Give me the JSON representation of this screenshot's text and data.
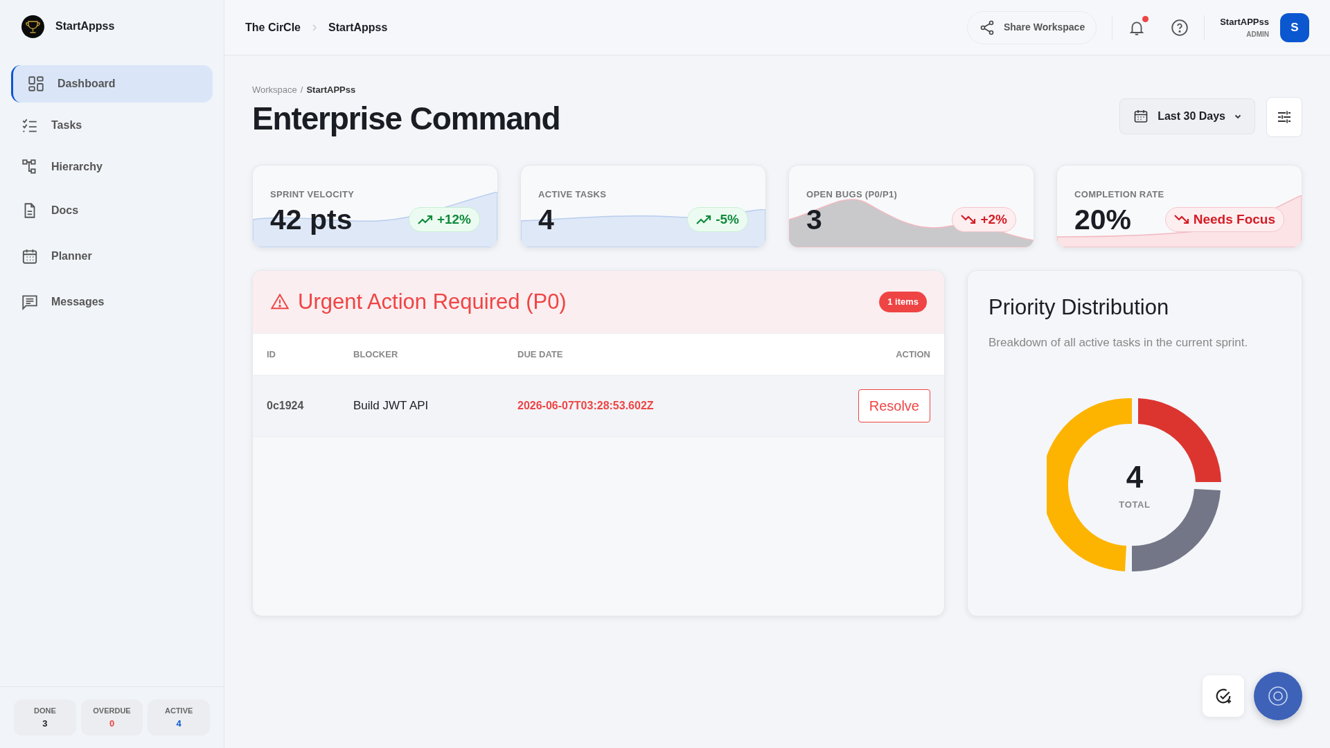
{
  "sidebar": {
    "brand": "StartAppss",
    "items": [
      {
        "label": "Dashboard",
        "selected": true
      },
      {
        "label": "Tasks",
        "selected": false
      },
      {
        "label": "Hierarchy",
        "selected": false
      },
      {
        "label": "Docs",
        "selected": false
      },
      {
        "label": "Planner",
        "selected": false
      },
      {
        "label": "Messages",
        "selected": false
      }
    ],
    "stats": [
      {
        "label": "DONE",
        "value": "3",
        "kind": "neutral"
      },
      {
        "label": "OVERDUE",
        "value": "0",
        "kind": "danger"
      },
      {
        "label": "ACTIVE",
        "value": "4",
        "kind": "info"
      }
    ]
  },
  "header": {
    "breadcrumb": [
      "The CirCle",
      "StartAppss"
    ],
    "share": "Share Workspace",
    "notifications_unread": true,
    "user": {
      "name": "StartAPPss",
      "role": "ADMIN",
      "initial": "S"
    }
  },
  "page": {
    "breadcrumb": [
      "Workspace",
      "/",
      "StartAPPss"
    ],
    "title": "Enterprise Command",
    "date_range": "Last 30 Days"
  },
  "metrics": [
    {
      "label": "SPRINT VELOCITY",
      "value": "42 pts",
      "trend": "+12%",
      "kind": "up"
    },
    {
      "label": "ACTIVE TASKS",
      "value": "4",
      "trend": "-5%",
      "kind": "up"
    },
    {
      "label": "OPEN BUGS (P0/P1)",
      "value": "3",
      "trend": "+2%",
      "kind": "down"
    },
    {
      "label": "COMPLETION RATE",
      "value": "20%",
      "trend": "Needs Focus",
      "kind": "down"
    }
  ],
  "urgent": {
    "title": "Urgent Action Required (P0)",
    "badge": "1 items",
    "columns": [
      "ID",
      "BLOCKER",
      "DUE DATE",
      "ACTION"
    ],
    "rows": [
      {
        "id": "0c1924",
        "blocker": "Build JWT API",
        "due": "2026-06-07T03:28:53.602Z",
        "action": "Resolve"
      }
    ]
  },
  "priority": {
    "title": "Priority Distribution",
    "subtitle": "Breakdown of all active tasks in the current sprint.",
    "total": "4",
    "total_label": "TOTAL"
  }
}
